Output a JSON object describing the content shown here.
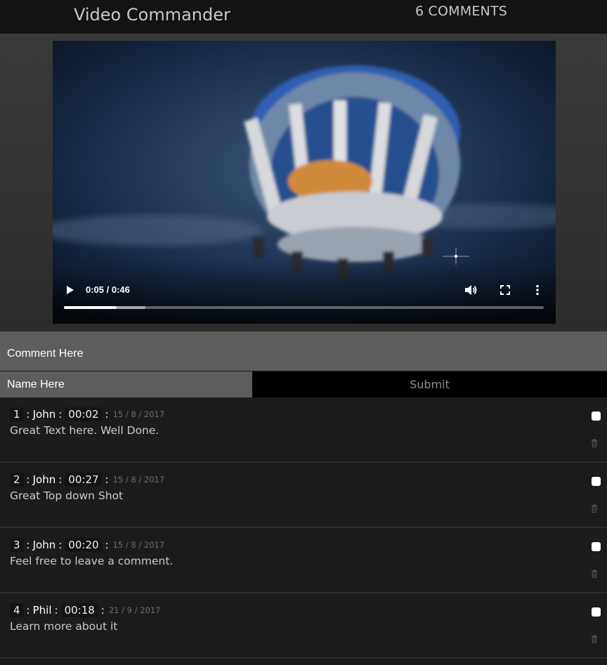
{
  "header": {
    "app_title": "Video Commander",
    "comment_count_label": "6 COMMENTS"
  },
  "player": {
    "time_display": "0:05 / 0:46",
    "current_time": "0:05",
    "duration": "0:46",
    "played_fraction": 0.11,
    "buffered_fraction": 0.17,
    "icons": [
      "play-icon",
      "volume-icon",
      "fullscreen-icon",
      "more-options-icon"
    ]
  },
  "form": {
    "comment_placeholder": "Comment Here",
    "name_placeholder": "Name Here",
    "submit_label": "Submit"
  },
  "comments": [
    {
      "number": "1",
      "author": "John",
      "timestamp": "00:02",
      "date": "15 / 8 / 2017",
      "text": "Great Text here. Well Done."
    },
    {
      "number": "2",
      "author": "John",
      "timestamp": "00:27",
      "date": "15 / 8 / 2017",
      "text": "Great Top down Shot"
    },
    {
      "number": "3",
      "author": "John",
      "timestamp": "00:20",
      "date": "15 / 8 / 2017",
      "text": "Feel free to leave a comment."
    },
    {
      "number": "4",
      "author": "Phil",
      "timestamp": "00:18",
      "date": "21 / 9 / 2017",
      "text": "Learn more about it"
    }
  ],
  "colors": {
    "topbar": "#131313",
    "input_bg": "#5d5d5d",
    "submit_bg": "#000000",
    "list_bg": "#1c1c1c"
  }
}
